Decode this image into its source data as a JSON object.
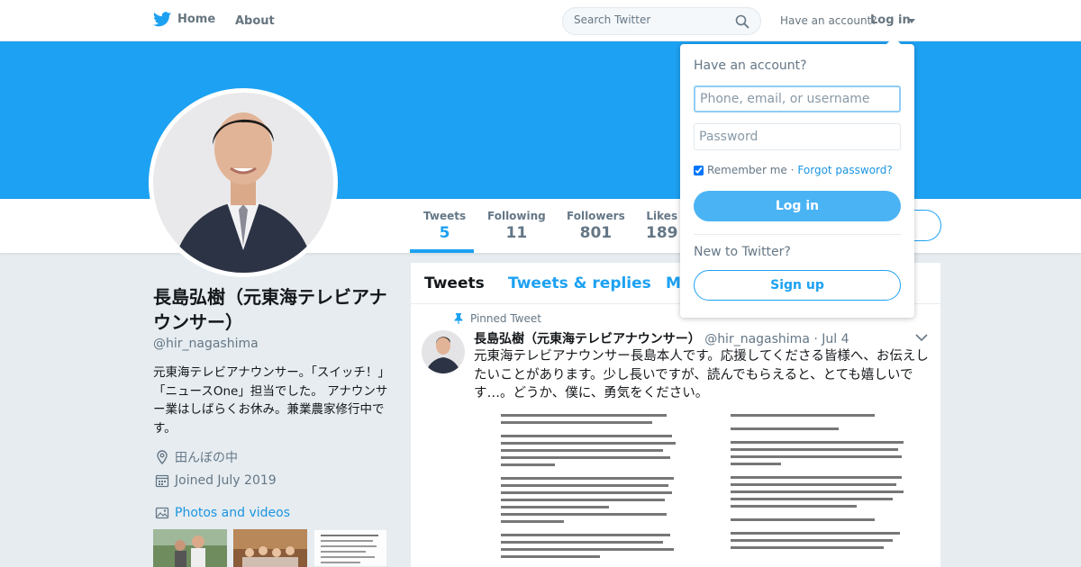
{
  "nav": {
    "home_label": "Home",
    "about_label": "About",
    "search_placeholder": "Search Twitter",
    "have_account": "Have an account?",
    "login_label": "Log in"
  },
  "profile": {
    "name": "長島弘樹（元東海テレビアナウンサー）",
    "handle": "@hir_nagashima",
    "bio": "元東海テレビアナウンサー。「スイッチ！」「ニュースOne」担当でした。 アナウンサー業はしばらくお休み。兼業農家修行中です。",
    "location": "田んぼの中",
    "joined": "Joined July 2019",
    "photos_label": "Photos and videos"
  },
  "stats": [
    {
      "label": "Tweets",
      "value": "5"
    },
    {
      "label": "Following",
      "value": "11"
    },
    {
      "label": "Followers",
      "value": "801"
    },
    {
      "label": "Likes",
      "value": "189"
    }
  ],
  "timeline": {
    "tabs": [
      "Tweets",
      "Tweets & replies",
      "M"
    ],
    "pinned_label": "Pinned Tweet",
    "tweet": {
      "name": "長島弘樹（元東海テレビアナウンサー）",
      "handle": "@hir_nagashima",
      "date": "· Jul 4",
      "text": "元東海テレビアナウンサー長島本人です。応援してくださる皆様へ、お伝えしたいことがあります。少し長いですが、読んでもらえると、とても嬉しいです…。どうか、僕に、勇気をください。"
    }
  },
  "login_dropdown": {
    "title": "Have an account?",
    "username_placeholder": "Phone, email, or username",
    "password_placeholder": "Password",
    "remember_label": "Remember me ·",
    "forgot_label": "Forgot password?",
    "login_button": "Log in",
    "new_label": "New to Twitter?",
    "signup_button": "Sign up"
  },
  "colors": {
    "accent": "#1da1f2",
    "banner": "#1da1f2",
    "login_button": "#4ab3f4"
  }
}
